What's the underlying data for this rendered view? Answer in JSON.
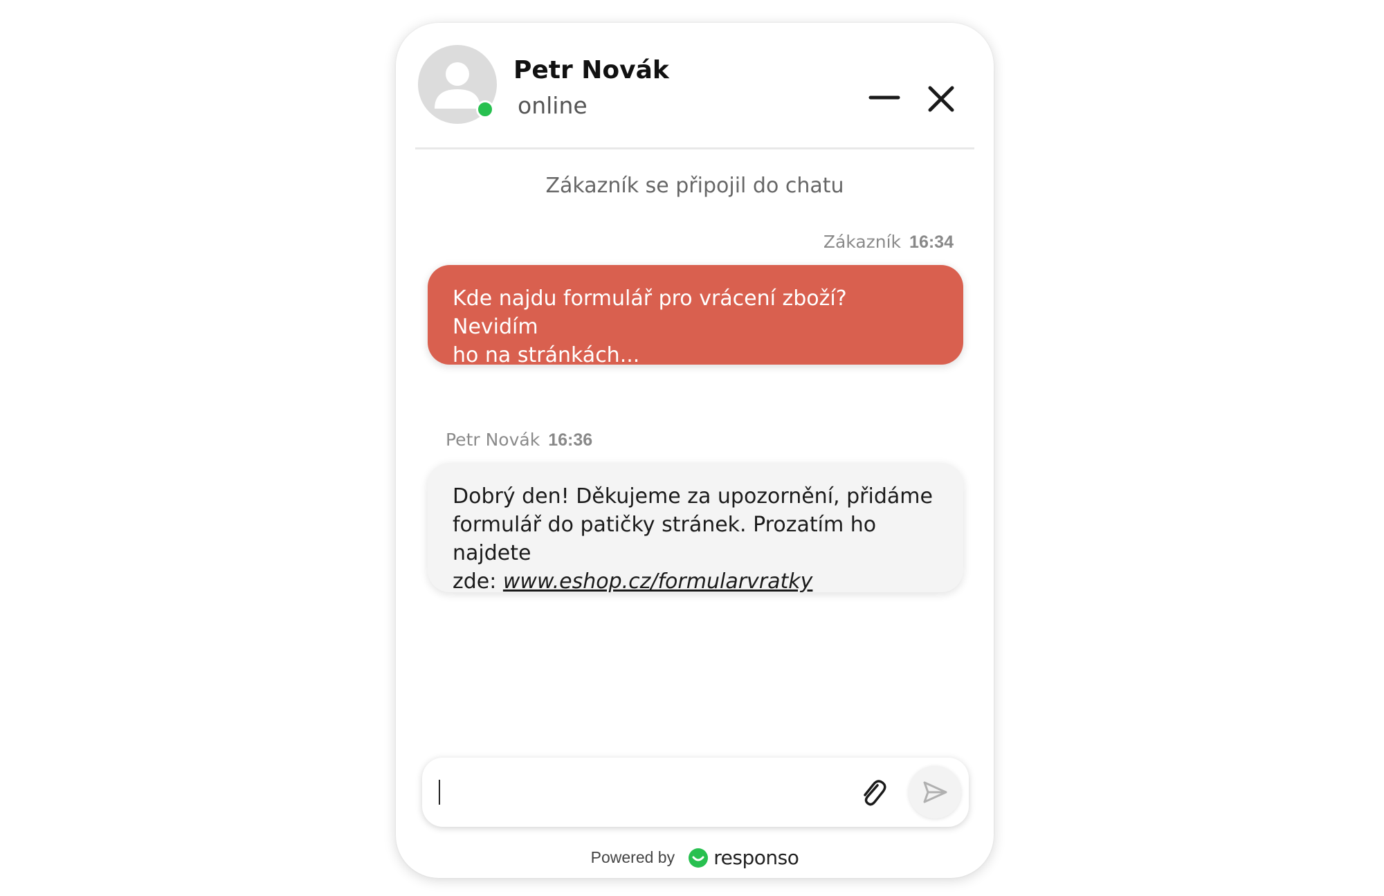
{
  "header": {
    "agent_name": "Petr Novák",
    "agent_status": "online",
    "avatar_icon": "user-placeholder-icon",
    "status_color": "#27c04f",
    "minimize_icon": "minimize-icon",
    "close_icon": "close-icon"
  },
  "messages": {
    "system_notice": "Zákazník se připojil do chatu",
    "customer": {
      "sender": "Zákazník",
      "time": "16:34",
      "line1": "Kde najdu formulář pro vrácení zboží? Nevidím",
      "line2": "ho na stránkách...",
      "bubble_color": "#d9604f"
    },
    "agent": {
      "sender": "Petr Novák",
      "time": "16:36",
      "line1": "Dobrý den! Děkujeme za upozornění, přidáme",
      "line2": "formulář do patičky stránek. Prozatím ho najdete",
      "line3_prefix": "zde: ",
      "link": "www.eshop.cz/formularvratky"
    }
  },
  "composer": {
    "value": "",
    "attach_icon": "paperclip-icon",
    "send_icon": "send-icon"
  },
  "footer": {
    "powered_label": "Powered by",
    "brand_name": "responso",
    "brand_color": "#27c04f"
  }
}
